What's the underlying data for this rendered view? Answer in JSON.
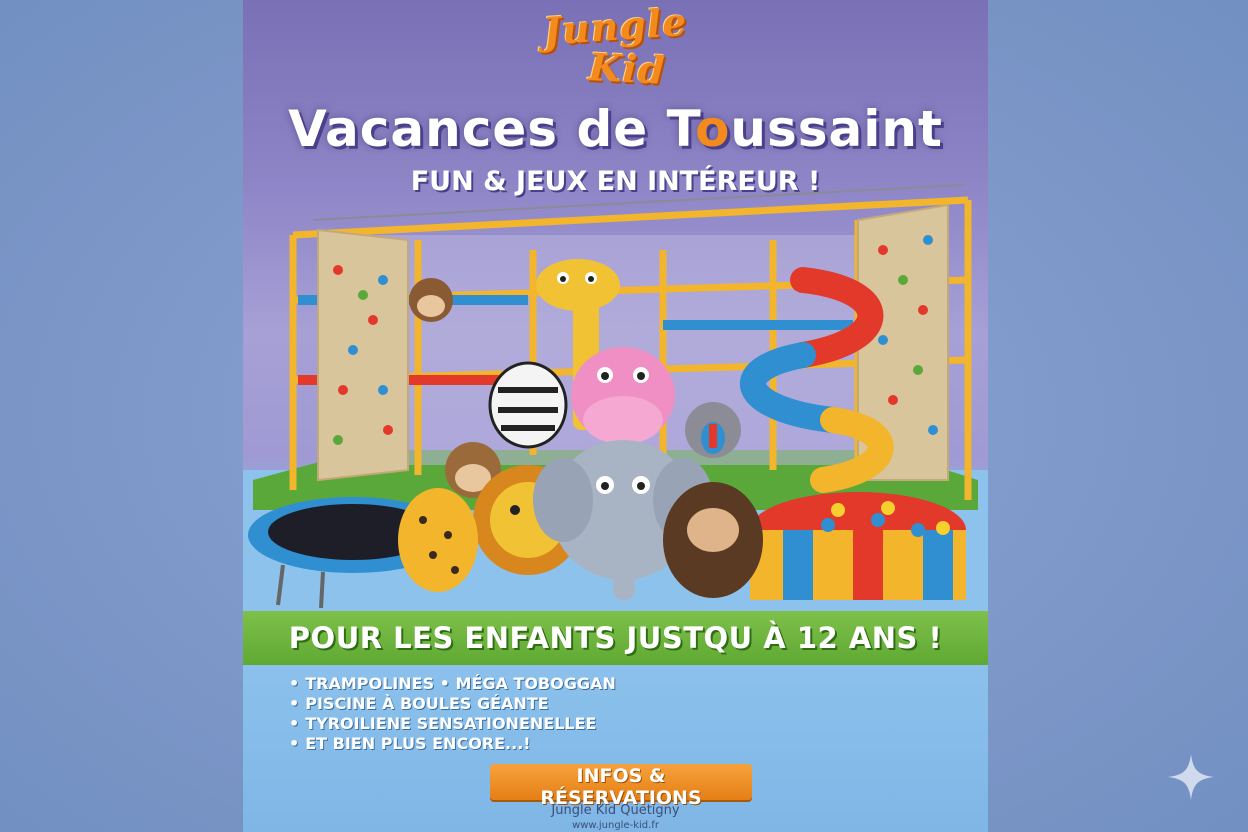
{
  "poster": {
    "logo_line1": "Jungle",
    "logo_line2": "Kid",
    "headline_pre": "Vacances de T",
    "headline_accent": "o",
    "headline_post": "ussaint",
    "subhead": "FUN & JEUX EN INTÉREUR !",
    "banner": "POUR LES ENFANTS JUSTQU À 12 ANS !",
    "features": [
      "TRAMPOLINES • MÉGA TOBOGGAN",
      "PISCINE À BOULES GÉANTE",
      "TYROILIENE SENSATIONENELLEE",
      "ET BIEN PLUS ENCORE...!"
    ],
    "cta_label": "INFOS & RÉSERVATIONS",
    "venue": "Jungle Kid Quetigny",
    "website": "www.jungle-kid.fr"
  },
  "colors": {
    "background": "#7f9bcb",
    "poster_top": "#7a70b6",
    "accent_orange": "#f28a1e",
    "banner_green": "#6bb43d",
    "pool_blue": "#8cc2ec"
  },
  "icons": {
    "corner": "sparkle-icon"
  }
}
